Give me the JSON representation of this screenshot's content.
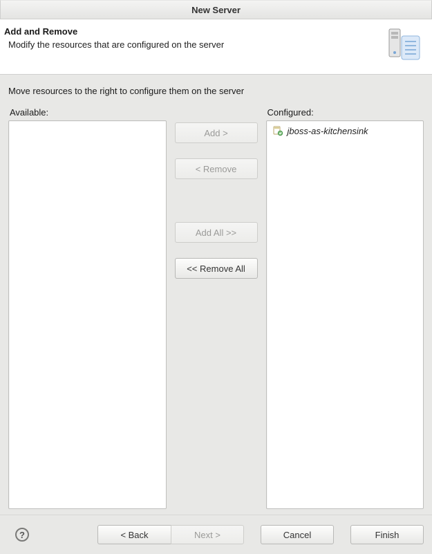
{
  "window": {
    "title": "New Server"
  },
  "banner": {
    "title": "Add and Remove",
    "subtitle": "Modify the resources that are configured on the server"
  },
  "main": {
    "instruction": "Move resources to the right to configure them on the server",
    "available_label": "Available:",
    "configured_label": "Configured:",
    "available_items": [],
    "configured_items": [
      "jboss-as-kitchensink"
    ]
  },
  "buttons": {
    "add": {
      "label": "Add >",
      "enabled": false
    },
    "remove": {
      "label": "< Remove",
      "enabled": false
    },
    "add_all": {
      "label": "Add All >>",
      "enabled": false
    },
    "remove_all": {
      "label": "<< Remove All",
      "enabled": true
    }
  },
  "nav": {
    "back": {
      "label": "< Back",
      "enabled": true
    },
    "next": {
      "label": "Next >",
      "enabled": false
    },
    "cancel": {
      "label": "Cancel",
      "enabled": true
    },
    "finish": {
      "label": "Finish",
      "enabled": true
    }
  }
}
